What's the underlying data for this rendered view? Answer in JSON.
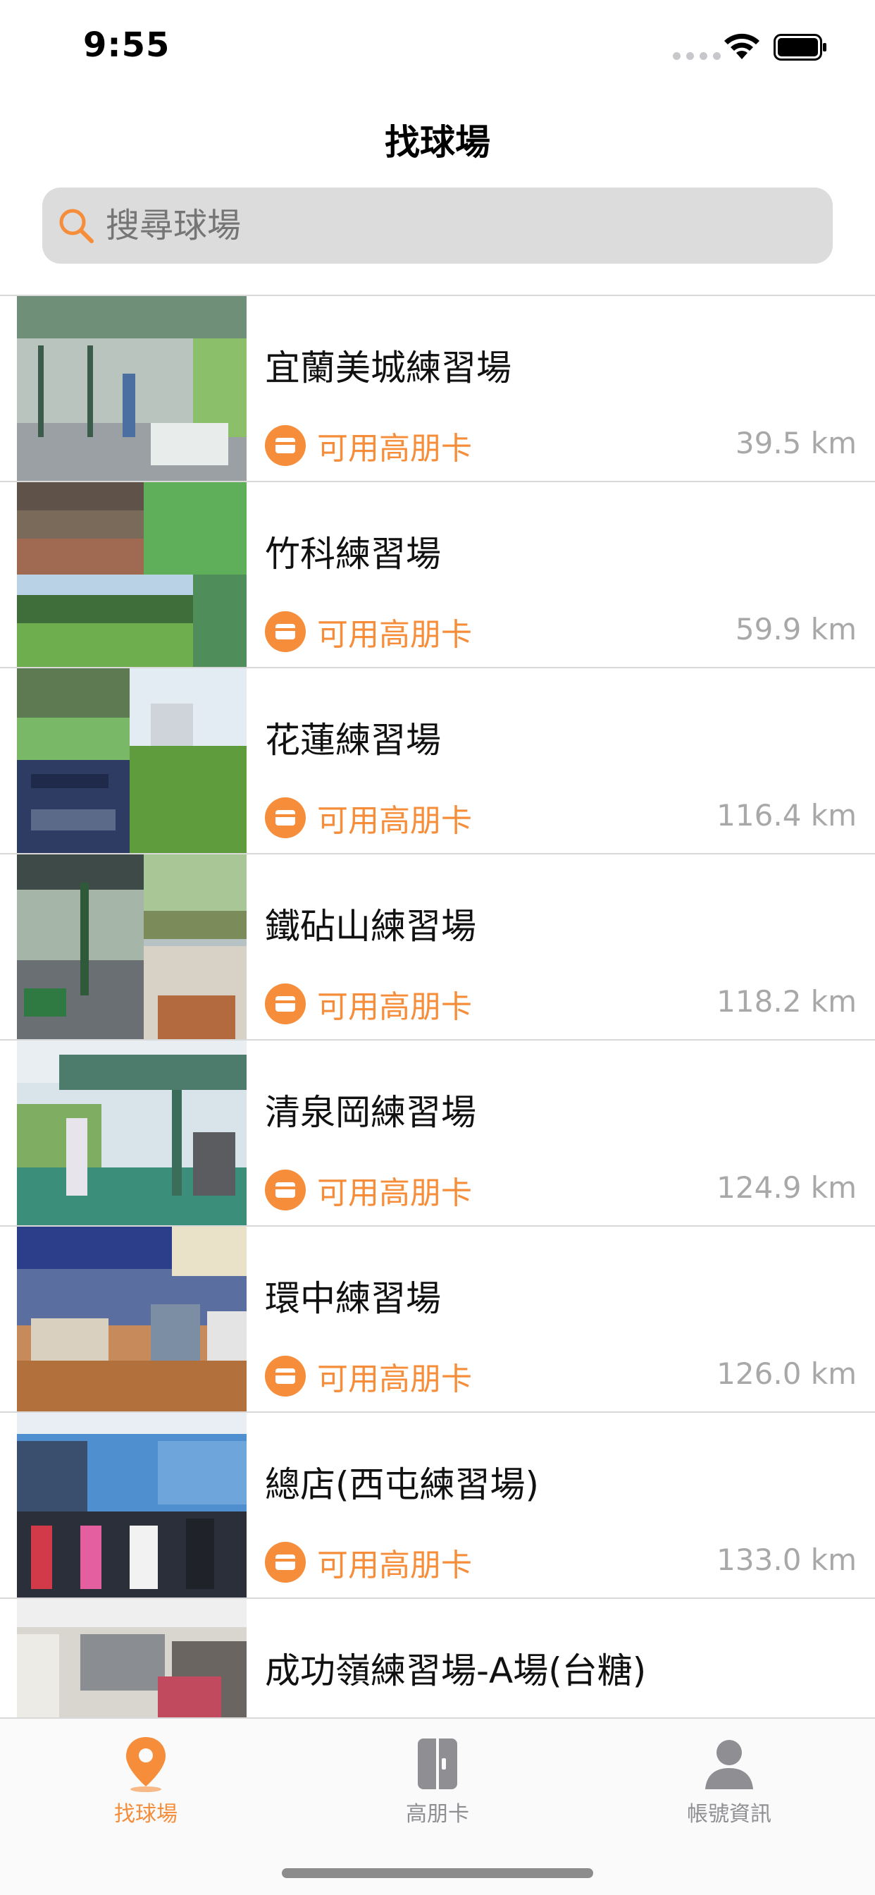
{
  "status": {
    "time": "9:55"
  },
  "nav": {
    "title": "找球場"
  },
  "search": {
    "placeholder": "搜尋球場"
  },
  "courses": [
    {
      "name": "宜蘭美城練習場",
      "badge": "可用高朋卡",
      "distance": "39.5 km"
    },
    {
      "name": "竹科練習場",
      "badge": "可用高朋卡",
      "distance": "59.9 km"
    },
    {
      "name": "花蓮練習場",
      "badge": "可用高朋卡",
      "distance": "116.4 km"
    },
    {
      "name": "鐵砧山練習場",
      "badge": "可用高朋卡",
      "distance": "118.2 km"
    },
    {
      "name": "清泉岡練習場",
      "badge": "可用高朋卡",
      "distance": "124.9 km"
    },
    {
      "name": "環中練習場",
      "badge": "可用高朋卡",
      "distance": "126.0 km"
    },
    {
      "name": "總店(西屯練習場)",
      "badge": "可用高朋卡",
      "distance": "133.0 km"
    },
    {
      "name": "成功嶺練習場-A場(台糖)",
      "badge": "",
      "distance": ""
    }
  ],
  "tabs": [
    {
      "label": "找球場",
      "icon": "location-pin-icon"
    },
    {
      "label": "高朋卡",
      "icon": "card-icon"
    },
    {
      "label": "帳號資訊",
      "icon": "account-icon"
    }
  ],
  "colors": {
    "accent": "#f58d3a",
    "search_bg": "#dcdcdc",
    "distance": "#a8a8a8"
  }
}
